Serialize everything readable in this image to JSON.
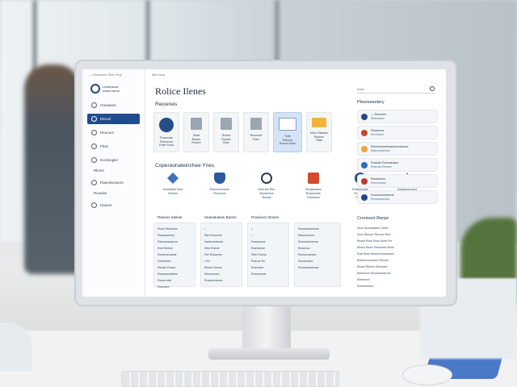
{
  "sidebar": {
    "top": "← • Dowaned Siine Ruy",
    "brand": [
      "Linweaooa",
      "woarn aeon"
    ],
    "items": [
      {
        "label": "Ooeaieee",
        "active": false
      },
      {
        "label": "Recod",
        "active": true
      },
      {
        "label": "Reooors",
        "active": false
      },
      {
        "label": "Plioe",
        "active": false
      },
      {
        "label": "Dordoogler",
        "active": false
      }
    ],
    "section1": "Rlrves",
    "items2": [
      {
        "label": "Raeeitsesanrs"
      },
      {
        "label": "Ruoviee"
      },
      {
        "label": "Daoere"
      }
    ]
  },
  "main": {
    "crumb": "Mid  ooos",
    "title": "Rolice Ilenes",
    "search_placeholder": "Raeir"
  },
  "files": {
    "label": "Reicenes",
    "items": [
      {
        "label": "Roarnoae\nPeiemooe\nRoiin Rnod"
      },
      {
        "label": "Sleaf\nReane\nRonere"
      },
      {
        "label": "Rnewt\nRaorlin\nBnte"
      },
      {
        "label": "Reooreet\nFlaer"
      },
      {
        "label": "Tivitr\nRannes\nRonne Raee"
      },
      {
        "label": "Mdor Rianses\nRsanoe\nRiatr"
      }
    ]
  },
  "tools": {
    "label": "Coperaonateinchee Ynes",
    "items": [
      {
        "label": "Sestwilter Bnd\nRoiieni"
      },
      {
        "label": "Rdecernesnee\nRoreecet"
      },
      {
        "label": "Deenes Res\nRoneneos\nRoneti"
      },
      {
        "label": "Benjasisiee\nRoaoeneie\nRoeeane"
      },
      {
        "label": "Rnaesnsiee\nRolsorrie\nRentin"
      },
      {
        "label": "Beasisooniset\nRoenai Raeos"
      }
    ]
  },
  "columns": [
    {
      "head": "Ranens Sieleer",
      "rows": [
        "Ruee Rneeeew",
        "Rosoeaoeriw",
        "Reenreasaerrnr",
        "Roe Reeeie",
        "Reareseoaeae",
        "Drreineiee",
        "Reosie Rosse",
        "Roeeseuhatiine",
        "Reaon elle",
        "Roeoeen"
      ]
    },
    {
      "head": "Seanatobeei Bantre",
      "rows": [
        "•",
        "Rite Resenne",
        "Saeieneneone",
        "Stiie Rneoe",
        "Rer Rousreen",
        "• Eb",
        "Reeee Senes",
        "Reoeenoes",
        "Rneeeeneees"
      ]
    },
    {
      "head": "Praoiinon Stnans",
      "rows": [
        "•",
        "•",
        "Rrasoones",
        "Raeiveese",
        "Rlee Roerie",
        "Roerne Ro",
        "Roeeoine",
        "Reeennsrie"
      ]
    },
    {
      "head": "",
      "rows": [
        "Reraneaeeeane",
        "Rieseeerees",
        "Roeetoeeoerne",
        "Reoeeoe",
        "Reeoeooeane",
        "Roeeeeianr",
        "Roeeesoaeeeat"
      ]
    }
  ],
  "right_panel": {
    "title": "Pleemeeelery",
    "items": [
      {
        "l1": "— Reoeeee",
        "l2": "Reeeoenee",
        "color": "#1f4a86"
      },
      {
        "l1": "Reaeenoe",
        "l2": "Rre Reoee",
        "color": "#c7462f"
      },
      {
        "l1": "Reeeeeeeeeneaneoeneeeoe",
        "l2": "Rabenmooenne",
        "color": "#f0a53a"
      },
      {
        "l1": "Ruaesie Rosnasoane",
        "l2": "Roeeneo Reeeee",
        "color": "#2f6db4"
      },
      {
        "l1": "Rieoeeieee",
        "l2": "Rrenneeeaer",
        "color": "#c0392b"
      },
      {
        "l1": "Rooroeoeeieeene",
        "l2": "Rnineeoeaones",
        "color": "#1f4a86"
      }
    ]
  },
  "right_panel2": {
    "title": "Crreinent Rerpe",
    "rows": [
      "Seoe Roeeeeaeee Geele",
      "Sooe Reemer Renone Beer",
      "Reoeb Rose Rooe Roeer Ee",
      "Reneo Rener Reniereee Reee",
      "Roel Reee Reeeenoeeoeneee",
      "Raeeerenonneoe Rsreren",
      "Reoee Rerene Reiueeee",
      "Reeeeeon Reeanoeeaenne",
      "Reeeneen",
      "Roeeeeeeere"
    ]
  }
}
